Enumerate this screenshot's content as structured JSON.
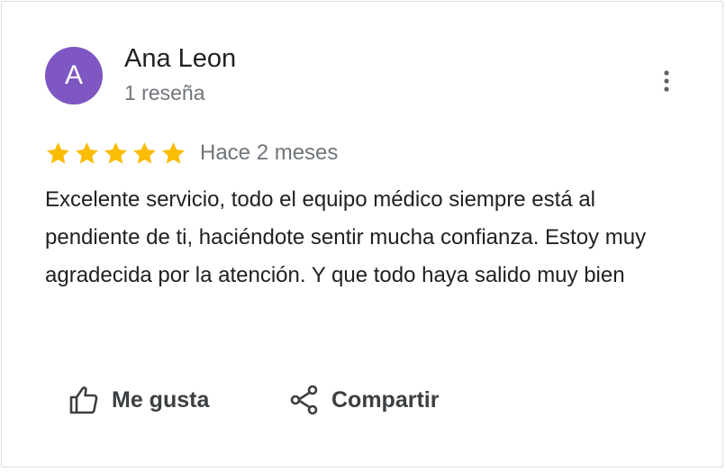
{
  "colors": {
    "avatar_bg": "#7e57c2",
    "star": "#fbbc04",
    "primary_text": "#202124",
    "secondary_text": "#70757a"
  },
  "reviewer": {
    "initial": "A",
    "name": "Ana Leon",
    "review_count": "1 reseña"
  },
  "menu": {
    "icon": "more-vert-icon"
  },
  "review": {
    "rating": 5,
    "rating_max": 5,
    "time": "Hace 2 meses",
    "text": "Excelente servicio, todo el equipo médico siempre está al pendiente de ti, haciéndote sentir mucha confianza. Estoy muy agradecida por la atención. Y que todo haya salido muy bien"
  },
  "actions": {
    "like": {
      "label": "Me gusta",
      "icon": "thumb-up-icon"
    },
    "share": {
      "label": "Compartir",
      "icon": "share-icon"
    }
  }
}
